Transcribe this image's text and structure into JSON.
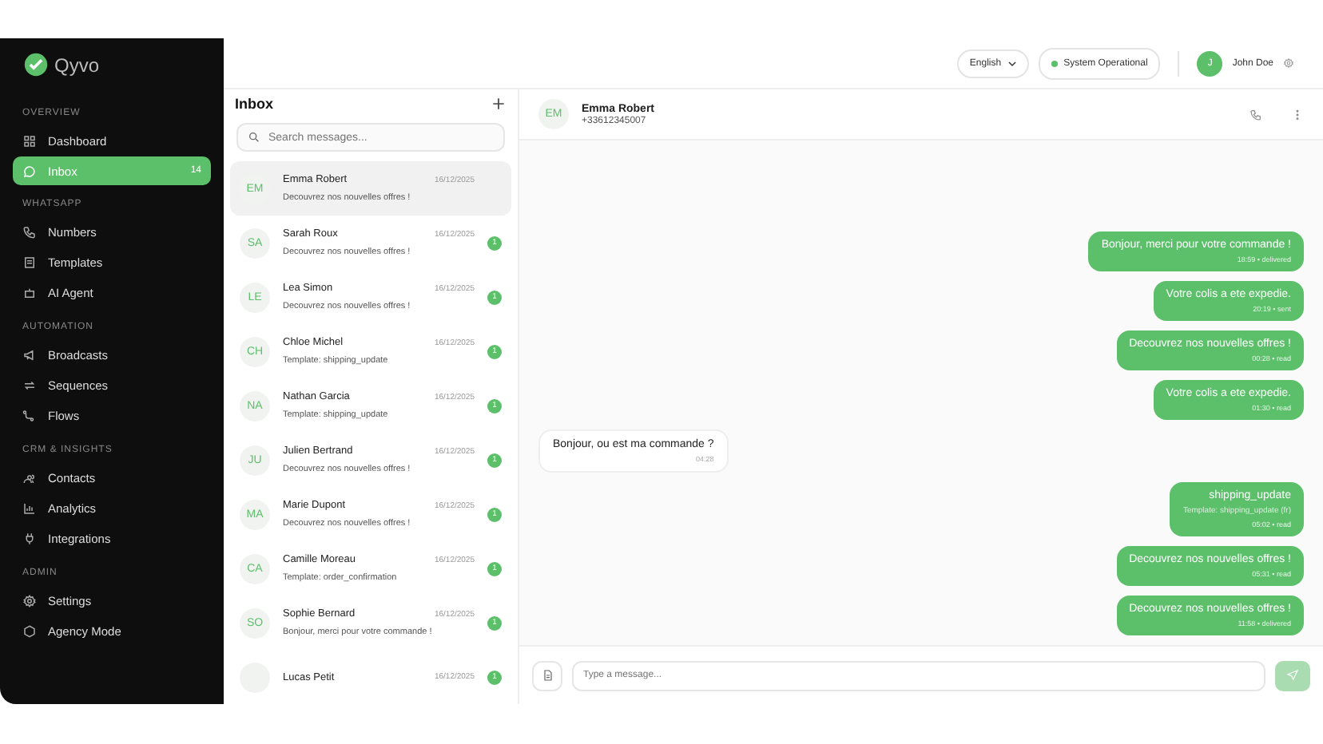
{
  "sidebar": {
    "logo": "Qyvo",
    "sections": [
      {
        "label": "OVERVIEW",
        "items": [
          {
            "label": "Dashboard",
            "selected": false
          },
          {
            "label": "Inbox",
            "selected": true,
            "badge": "14"
          }
        ]
      },
      {
        "label": "WHATSAPP",
        "items": [
          {
            "label": "Numbers",
            "selected": false
          },
          {
            "label": "Templates",
            "selected": false
          },
          {
            "label": "AI Agent",
            "selected": false
          }
        ]
      },
      {
        "label": "AUTOMATION",
        "items": [
          {
            "label": "Broadcasts",
            "selected": false
          },
          {
            "label": "Sequences",
            "selected": false
          },
          {
            "label": "Flows",
            "selected": false
          }
        ]
      },
      {
        "label": "CRM & INSIGHTS",
        "items": [
          {
            "label": "Contacts",
            "selected": false
          },
          {
            "label": "Analytics",
            "selected": false
          },
          {
            "label": "Integrations",
            "selected": false
          }
        ]
      },
      {
        "label": "ADMIN",
        "items": [
          {
            "label": "Settings",
            "selected": false
          },
          {
            "label": "Agency Mode",
            "selected": false
          }
        ]
      }
    ]
  },
  "topbar": {
    "language": "English",
    "status": "System Operational",
    "user": {
      "initial": "J",
      "name": "John Doe"
    }
  },
  "inbox": {
    "title": "Inbox",
    "search": {
      "placeholder": "Search messages..."
    },
    "conversations": [
      {
        "initials": "EM",
        "name": "Emma Robert",
        "date": "16/12/2025",
        "preview": "Decouvrez nos nouvelles offres !",
        "selected": true
      },
      {
        "initials": "SA",
        "name": "Sarah Roux",
        "date": "16/12/2025",
        "preview": "Decouvrez nos nouvelles offres !",
        "selected": false,
        "unread": "1"
      },
      {
        "initials": "LE",
        "name": "Lea Simon",
        "date": "16/12/2025",
        "preview": "Decouvrez nos nouvelles offres !",
        "selected": false,
        "unread": "1"
      },
      {
        "initials": "CH",
        "name": "Chloe Michel",
        "date": "16/12/2025",
        "preview": "Template: shipping_update",
        "selected": false,
        "unread": "1"
      },
      {
        "initials": "NA",
        "name": "Nathan Garcia",
        "date": "16/12/2025",
        "preview": "Template: shipping_update",
        "selected": false,
        "unread": "1"
      },
      {
        "initials": "JU",
        "name": "Julien Bertrand",
        "date": "16/12/2025",
        "preview": "Decouvrez nos nouvelles offres !",
        "selected": false,
        "unread": "1"
      },
      {
        "initials": "MA",
        "name": "Marie Dupont",
        "date": "16/12/2025",
        "preview": "Decouvrez nos nouvelles offres !",
        "selected": false,
        "unread": "1"
      },
      {
        "initials": "CA",
        "name": "Camille Moreau",
        "date": "16/12/2025",
        "preview": "Template: order_confirmation",
        "selected": false,
        "unread": "1"
      },
      {
        "initials": "SO",
        "name": "Sophie Bernard",
        "date": "16/12/2025",
        "preview": "Bonjour, merci pour votre commande !",
        "selected": false,
        "unread": "1"
      },
      {
        "name": "Lucas Petit",
        "date": "16/12/2025",
        "selected": false,
        "unread": "1"
      }
    ]
  },
  "chat": {
    "contact": {
      "initials": "EM",
      "name": "Emma Robert",
      "phone": "+33612345007"
    },
    "messages": [
      {
        "kind": "outgoing",
        "text": "Bonjour, merci pour votre commande !",
        "meta": "18:59 • delivered"
      },
      {
        "kind": "outgoing",
        "text": "Votre colis a ete expedie.",
        "meta": "20:19 • sent"
      },
      {
        "kind": "outgoing",
        "text": "Decouvrez nos nouvelles offres !",
        "meta": "00:28 • read"
      },
      {
        "kind": "outgoing",
        "text": "Votre colis a ete expedie.",
        "meta": "01:30 • read"
      },
      {
        "kind": "incoming",
        "text": "Bonjour, ou est ma commande ?",
        "meta": "04:28"
      },
      {
        "kind": "outgoing",
        "text": "shipping_update",
        "template": "Template: shipping_update (fr)",
        "meta": "05:02 • read"
      },
      {
        "kind": "outgoing",
        "text": "Decouvrez nos nouvelles offres !",
        "meta": "05:31 • read"
      },
      {
        "kind": "outgoing",
        "text": "Decouvrez nos nouvelles offres !",
        "meta": "11:58 • delivered"
      }
    ],
    "composer": {
      "placeholder": "Type a message..."
    }
  }
}
